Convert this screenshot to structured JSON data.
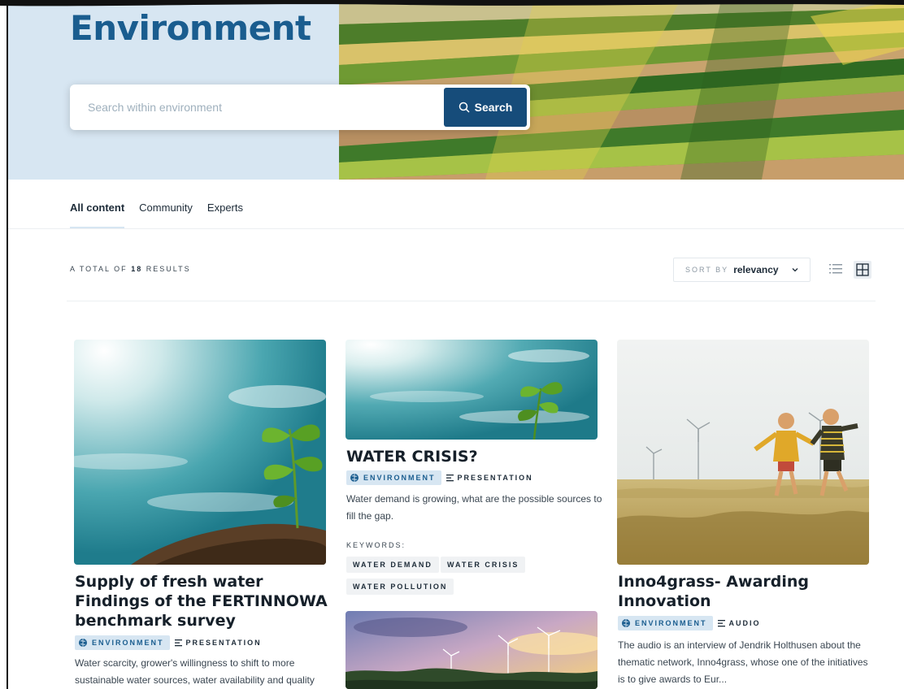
{
  "hero": {
    "title": "Environment",
    "search_placeholder": "Search within environment",
    "search_button": "Search"
  },
  "tabs": [
    {
      "label": "All content",
      "active": true
    },
    {
      "label": "Community",
      "active": false
    },
    {
      "label": "Experts",
      "active": false
    }
  ],
  "toolbar": {
    "results_prefix": "A TOTAL OF",
    "results_count": "18",
    "results_suffix": "RESULTS",
    "sort_label": "SORT BY",
    "sort_value": "relevancy"
  },
  "cards": [
    {
      "title": "Supply of fresh water Findings of the FERTINNOWA benchmark survey",
      "category": "ENVIRONMENT",
      "type": "PRESENTATION",
      "description": "Water scarcity, grower's willingness to shift to more sustainable water sources, water availability and quality"
    },
    {
      "title": "WATER CRISIS?",
      "category": "ENVIRONMENT",
      "type": "PRESENTATION",
      "description": "Water demand is growing, what are the possible sources to fill the gap.",
      "keywords_label": "KEYWORDS:",
      "keywords": [
        "WATER DEMAND",
        "WATER CRISIS",
        "WATER POLLUTION"
      ]
    },
    {
      "title": "Inno4grass- Awarding Innovation",
      "category": "ENVIRONMENT",
      "type": "AUDIO",
      "description": "The audio is an interview of Jendrik Holthusen about the thematic network, Inno4grass, whose one of the initiatives is to give awards to Eur..."
    }
  ],
  "colors": {
    "brand_blue": "#1a5d8f",
    "button_blue": "#164c7a",
    "hero_bg": "#d7e6f2"
  }
}
